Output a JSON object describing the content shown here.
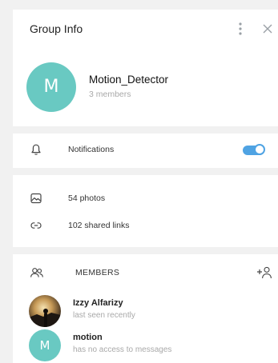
{
  "header": {
    "title": "Group Info",
    "more_icon": "more-vertical-icon",
    "close_icon": "close-icon"
  },
  "group": {
    "avatar_letter": "M",
    "name": "Motion_Detector",
    "subtitle": "3 members",
    "avatar_color": "#69c9c2"
  },
  "notifications": {
    "label": "Notifications",
    "enabled": true,
    "toggle_color": "#4fa3e3"
  },
  "media": {
    "photos_label": "54 photos",
    "links_label": "102 shared links"
  },
  "members": {
    "label": "MEMBERS",
    "list": [
      {
        "name": "Izzy Alfarizy",
        "status": "last seen recently"
      },
      {
        "name": "motion",
        "status": "has no access to messages",
        "avatar_letter": "M"
      }
    ]
  }
}
